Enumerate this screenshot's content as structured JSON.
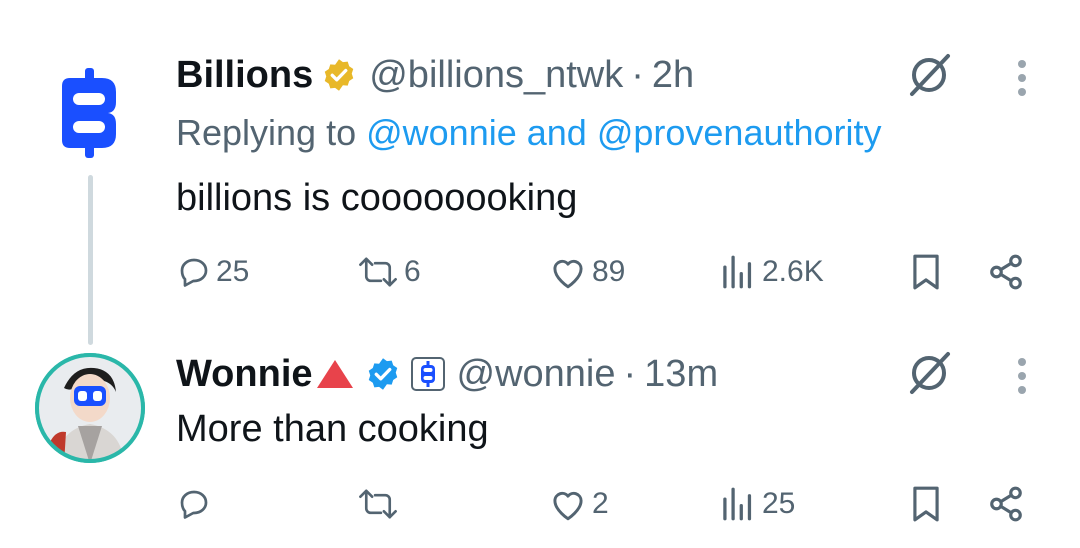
{
  "tweet1": {
    "name": "Billions",
    "handle": "@billions_ntwk",
    "separator": "·",
    "time": "2h",
    "replying_prefix": "Replying to",
    "replying_user1": "@wonnie",
    "replying_and": "and",
    "replying_user2": "@provenauthority",
    "text": "billions is coooooooking",
    "stats": {
      "replies": "25",
      "reposts": "6",
      "likes": "89",
      "views": "2.6K"
    }
  },
  "tweet2": {
    "name": "Wonnie",
    "handle": "@wonnie",
    "separator": "·",
    "time": "13m",
    "text": "More than cooking",
    "stats": {
      "replies": "",
      "reposts": "",
      "likes": "2",
      "views": "25"
    }
  },
  "colors": {
    "link": "#1d9bf0",
    "secondary": "#536471",
    "gold_badge": "#e8b829",
    "blue_badge": "#1d9bf0",
    "billions_blue": "#1a4fff",
    "red_triangle": "#e8434b"
  },
  "icons": [
    "billions-logo-icon",
    "gold-verified-icon",
    "blue-verified-icon",
    "billions-affiliate-icon",
    "grok-icon",
    "more-vertical-icon",
    "reply-icon",
    "repost-icon",
    "like-icon",
    "views-icon",
    "bookmark-icon",
    "share-icon"
  ]
}
